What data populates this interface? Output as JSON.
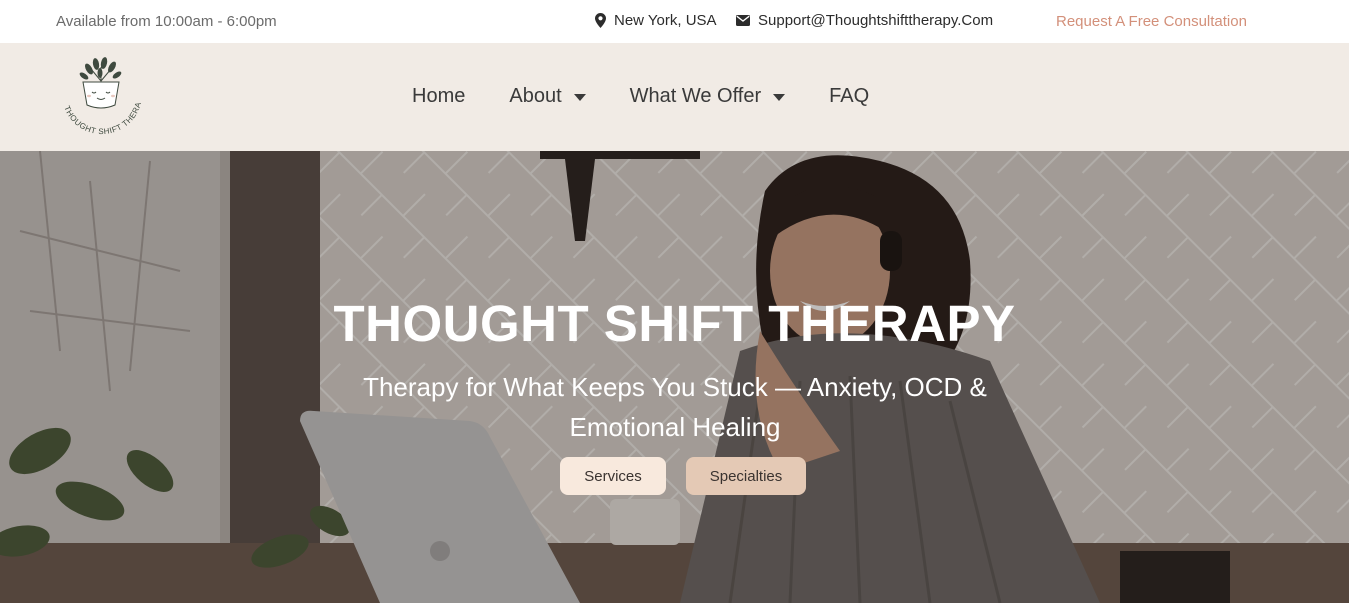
{
  "topbar": {
    "hours": "Available from 10:00am - 6:00pm",
    "location": "New York, USA",
    "email": "Support@Thoughtshifttherapy.Com",
    "cta": "Request A Free Consultation",
    "cta_color": "#d3907a"
  },
  "header": {
    "logo_text": "THOUGHT SHIFT THERAPY",
    "nav": [
      {
        "label": "Home",
        "has_dropdown": false
      },
      {
        "label": "About",
        "has_dropdown": true
      },
      {
        "label": "What We Offer",
        "has_dropdown": true
      },
      {
        "label": "FAQ",
        "has_dropdown": false
      }
    ],
    "background": "#f1ebe5"
  },
  "hero": {
    "title": "THOUGHT SHIFT THERAPY",
    "subtitle": "Therapy for What Keeps You Stuck — Anxiety, OCD & Emotional Healing",
    "buttons": {
      "services": "Services",
      "specialties": "Specialties"
    },
    "button_colors": {
      "services": "#f8e9dd",
      "specialties": "#e4c9b5"
    }
  },
  "icons": {
    "location": "map-pin-icon",
    "email": "envelope-icon",
    "dropdown": "caret-down-icon"
  }
}
